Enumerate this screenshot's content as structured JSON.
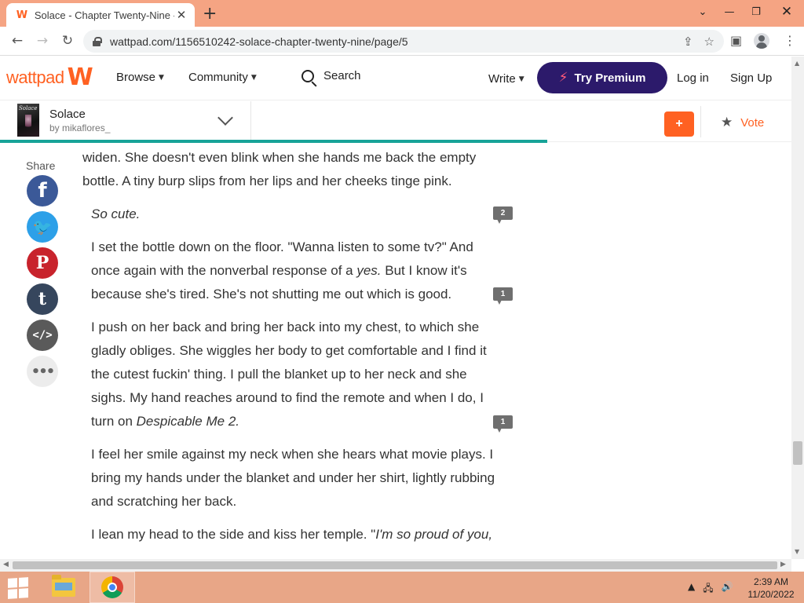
{
  "browser": {
    "tab_title": "Solace - Chapter Twenty-Nine - ",
    "tab_favicon": "W",
    "new_tab": "+",
    "url": "wattpad.com/1156510242-solace-chapter-twenty-nine/page/5",
    "controls": {
      "minimize": "—",
      "maximize": "❐",
      "close": "✕"
    }
  },
  "header": {
    "logo_text": "wattpad",
    "logo_mark": "W",
    "browse": "Browse",
    "community": "Community",
    "search": "Search",
    "write": "Write",
    "premium": "Try Premium",
    "login": "Log in",
    "signup": "Sign Up"
  },
  "story": {
    "title": "Solace",
    "author": "by mikaflores_",
    "cover_title": "Solace",
    "add_label": "+",
    "vote_label": "Vote",
    "progress_fraction": 0.69
  },
  "share": {
    "label": "Share",
    "buttons": [
      "f",
      "🐦",
      "P",
      "t",
      "</>",
      "•••"
    ]
  },
  "content": {
    "p1a": "widen. She doesn't even blink when she hands me back the empty bottle. A tiny burp slips from her lips and her cheeks tinge pink.",
    "p2": "So cute.",
    "p3a": "I set the bottle down on the floor. \"Wanna listen to some tv?\" And once again with the nonverbal response of a ",
    "p3b": "yes.",
    "p3c": " But I know it's because she's tired. She's not shutting me out which is good.",
    "p4a": "I push on her back and bring her back into my chest, to which she gladly obliges. She wiggles her body to get comfortable and I find it the cutest fuckin' thing. I pull the blanket up to her neck and she sighs. My hand reaches around to find the remote and when I do, I turn on ",
    "p4b": "Despicable Me 2.",
    "p5": "I feel her smile against my neck when she hears what movie plays. I bring my hands under the blanket and under her shirt, lightly rubbing and scratching her back.",
    "p6a": "I lean my head to the side and kiss her temple. \"",
    "p6b": "I'm so proud of you,",
    "comments": [
      "2",
      "1",
      "1"
    ]
  },
  "taskbar": {
    "time": "2:39 AM",
    "date": "11/20/2022"
  }
}
